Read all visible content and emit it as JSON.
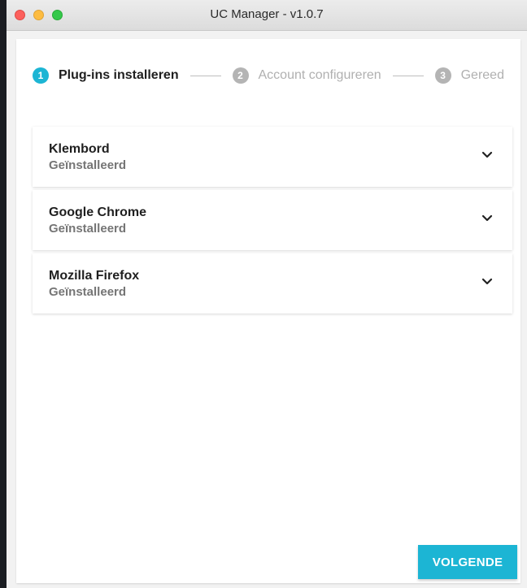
{
  "window": {
    "title": "UC Manager - v1.0.7"
  },
  "stepper": {
    "steps": [
      {
        "number": "1",
        "label": "Plug-ins installeren",
        "state": "active"
      },
      {
        "number": "2",
        "label": "Account configureren",
        "state": "inactive"
      },
      {
        "number": "3",
        "label": "Gereed",
        "state": "inactive"
      }
    ]
  },
  "plugins": [
    {
      "name": "Klembord",
      "status": "Geïnstalleerd",
      "icon": "chevron-down-icon"
    },
    {
      "name": "Google Chrome",
      "status": "Geïnstalleerd",
      "icon": "chevron-down-icon"
    },
    {
      "name": "Mozilla Firefox",
      "status": "Geïnstalleerd",
      "icon": "chevron-down-icon"
    }
  ],
  "actions": {
    "next_label": "VOLGENDE"
  },
  "colors": {
    "accent": "#1cb5d4",
    "inactive": "#b4b4b4"
  }
}
